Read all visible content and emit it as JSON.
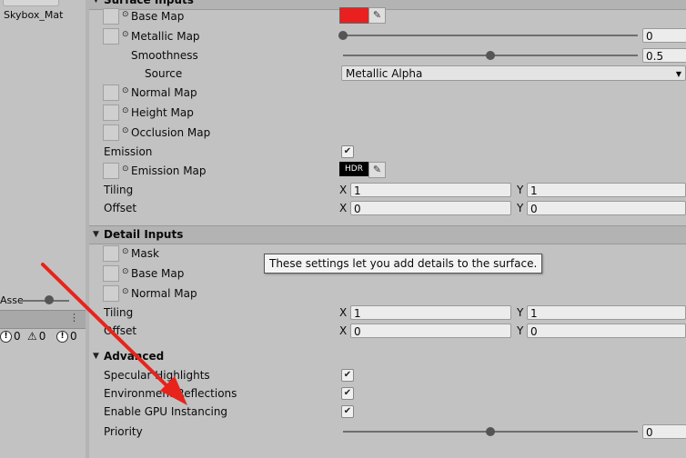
{
  "left_panel": {
    "asset_name": "Skybox_Mat",
    "zoom_label": "Asse",
    "counts": {
      "info": "0",
      "warning": "0",
      "error": "0"
    }
  },
  "surface": {
    "header": "Surface Inputs",
    "base_map": "Base Map",
    "metallic_map": "Metallic Map",
    "metallic_value": "0",
    "smoothness": "Smoothness",
    "smoothness_value": "0.5",
    "source": "Source",
    "source_value": "Metallic Alpha",
    "normal_map": "Normal Map",
    "height_map": "Height Map",
    "occlusion_map": "Occlusion Map",
    "emission": "Emission",
    "emission_map": "Emission Map",
    "hdr": "HDR",
    "tiling": "Tiling",
    "offset": "Offset",
    "tiling_x": "1",
    "tiling_y": "1",
    "offset_x": "0",
    "offset_y": "0",
    "x": "X",
    "y": "Y"
  },
  "detail": {
    "header": "Detail Inputs",
    "mask": "Mask",
    "base_map": "Base Map",
    "normal_map": "Normal Map",
    "tiling": "Tiling",
    "offset": "Offset",
    "tiling_x": "1",
    "tiling_y": "1",
    "offset_x": "0",
    "offset_y": "0",
    "x": "X",
    "y": "Y"
  },
  "tooltip": "These settings let you add details to the surface.",
  "advanced": {
    "header": "Advanced",
    "specular_highlights": "Specular Highlights",
    "environment_reflections": "Environment Reflections",
    "gpu_instancing": "Enable GPU Instancing",
    "priority": "Priority",
    "priority_value": "0"
  },
  "sliders": {
    "metallic": 0.0,
    "smoothness": 0.5,
    "priority": 0.5
  },
  "colors": {
    "base_color": "#ea1f1f",
    "annotation_arrow": "#e8231b"
  },
  "icons": {
    "picker": "eyedropper-icon",
    "check": "checkmark-icon",
    "foldout": "triangle-down-icon"
  }
}
